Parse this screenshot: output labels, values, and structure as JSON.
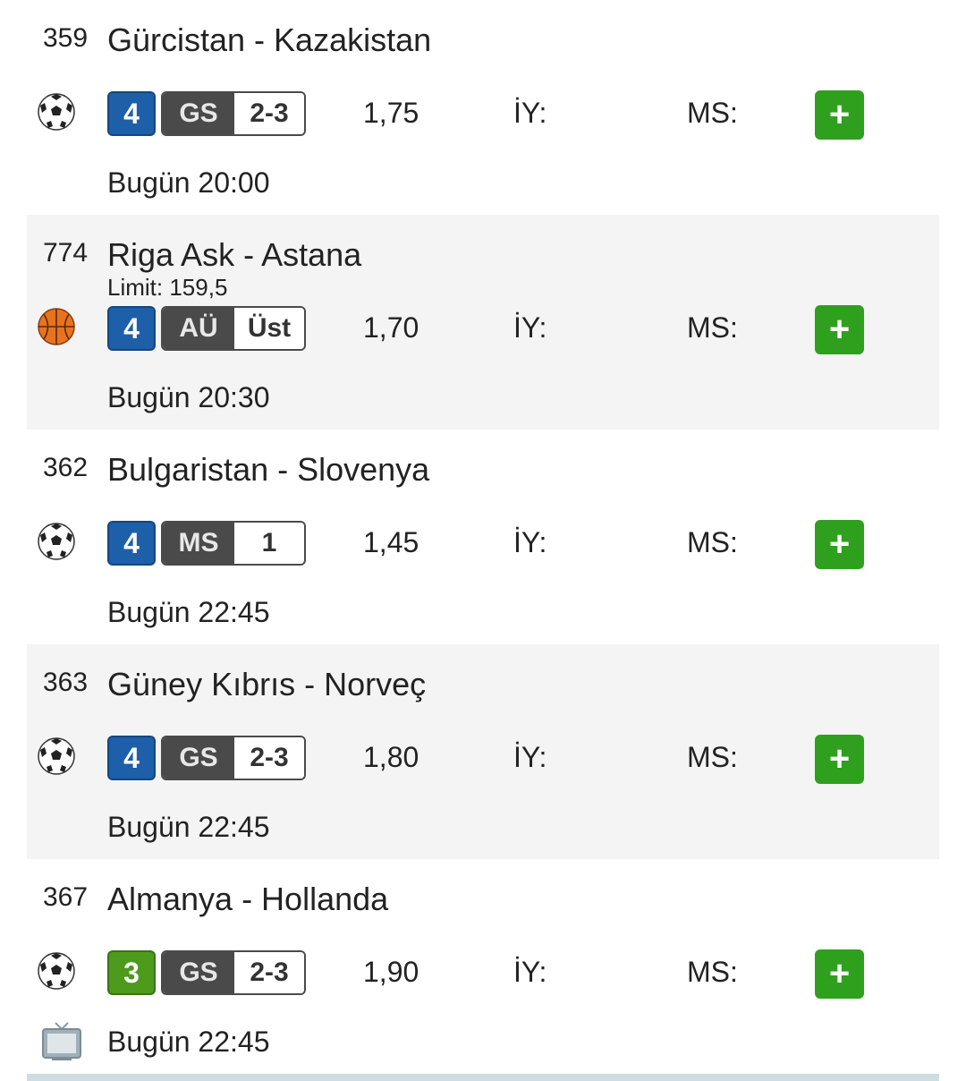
{
  "colors": {
    "mbs_blue": "#1d5fa8",
    "mbs_green": "#4d9a1c",
    "add_button": "#2fa01e",
    "bet_type_bg": "#4a4a4a"
  },
  "labels": {
    "iy": "İY:",
    "ms": "MS:",
    "add": "+"
  },
  "matches": [
    {
      "code": "359",
      "teams": "Gürcistan - Kazakistan",
      "limit": "",
      "sport": "football-icon",
      "mbs": "4",
      "mbs_color": "blue",
      "bet_type": "GS",
      "bet_pick": "2-3",
      "odd": "1,75",
      "time": "Bugün 20:00",
      "tv": false
    },
    {
      "code": "774",
      "teams": "Riga Ask - Astana",
      "limit": "Limit: 159,5",
      "sport": "basketball-icon",
      "mbs": "4",
      "mbs_color": "blue",
      "bet_type": "AÜ",
      "bet_pick": "Üst",
      "odd": "1,70",
      "time": "Bugün 20:30",
      "tv": false
    },
    {
      "code": "362",
      "teams": "Bulgaristan - Slovenya",
      "limit": "",
      "sport": "football-icon",
      "mbs": "4",
      "mbs_color": "blue",
      "bet_type": "MS",
      "bet_pick": "1",
      "odd": "1,45",
      "time": "Bugün 22:45",
      "tv": false
    },
    {
      "code": "363",
      "teams": "Güney Kıbrıs - Norveç",
      "limit": "",
      "sport": "football-icon",
      "mbs": "4",
      "mbs_color": "blue",
      "bet_type": "GS",
      "bet_pick": "2-3",
      "odd": "1,80",
      "time": "Bugün 22:45",
      "tv": false
    },
    {
      "code": "367",
      "teams": "Almanya - Hollanda",
      "limit": "",
      "sport": "football-icon",
      "mbs": "3",
      "mbs_color": "green",
      "bet_type": "GS",
      "bet_pick": "2-3",
      "odd": "1,90",
      "time": "Bugün 22:45",
      "tv": true
    }
  ]
}
